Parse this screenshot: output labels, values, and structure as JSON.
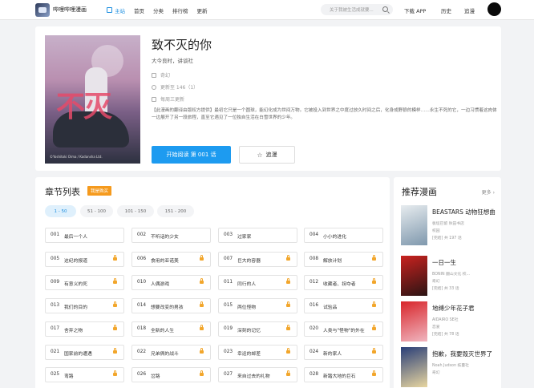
{
  "header": {
    "brand": "哔哩哔哩漫画",
    "nav": [
      {
        "label": "主站",
        "active": true
      },
      {
        "label": "首页",
        "active": false
      },
      {
        "label": "分类",
        "active": false
      },
      {
        "label": "排行榜",
        "active": false
      },
      {
        "label": "更新",
        "active": false
      }
    ],
    "search_placeholder": "关于我被生活成就要...",
    "download": "下载 APP",
    "history": "历史",
    "follow": "追漫"
  },
  "comic": {
    "title": "致不灭的你",
    "author": "大今良时，讲谈社",
    "genre": "奇幻",
    "update_status": "更新至 146（1）",
    "schedule": "每周三更新",
    "description": "【此漫画的翻译由版权方提供】最初它只是一个圆球，能幻化成为世间万物。它被投入到世界之中度过放久时间之后，化身成野狼的模样……永生不死的它，一边习惯着这肉体一边展开了另一段旅程，直至它遇见了一位独自生活在白雪世界的少年。",
    "cover_credit": "©Yoshitoki Oima / Kodansha Ltd.",
    "read_button": "开始阅读 第 001 话",
    "follow_button": "追漫"
  },
  "chapters": {
    "title": "章节列表",
    "badge": "我是购买",
    "ranges": [
      "1 - 50",
      "51 - 100",
      "101 - 150",
      "151 - 200"
    ],
    "items": [
      {
        "num": "001",
        "name": "最后一个人",
        "locked": false
      },
      {
        "num": "002",
        "name": "不听话的少女",
        "locked": false
      },
      {
        "num": "003",
        "name": "过家家",
        "locked": false
      },
      {
        "num": "004",
        "name": "小小的进化",
        "locked": false
      },
      {
        "num": "005",
        "name": "这纪的报道",
        "locked": true
      },
      {
        "num": "006",
        "name": "食用的亚诺美",
        "locked": true
      },
      {
        "num": "007",
        "name": "巨大的容器",
        "locked": true
      },
      {
        "num": "008",
        "name": "解放计划",
        "locked": true
      },
      {
        "num": "009",
        "name": "有意义的死",
        "locked": true
      },
      {
        "num": "010",
        "name": "人偶游戏",
        "locked": true
      },
      {
        "num": "011",
        "name": "同行的人",
        "locked": true
      },
      {
        "num": "012",
        "name": "收藏者、拐夺者",
        "locked": true
      },
      {
        "num": "013",
        "name": "我们的目的",
        "locked": true
      },
      {
        "num": "014",
        "name": "想要改变的男孩",
        "locked": true
      },
      {
        "num": "015",
        "name": "两位怪物",
        "locked": true
      },
      {
        "num": "016",
        "name": "试验品",
        "locked": true
      },
      {
        "num": "017",
        "name": "舍弃之物",
        "locked": true
      },
      {
        "num": "018",
        "name": "全新的人生",
        "locked": true
      },
      {
        "num": "019",
        "name": "深刻的记忆",
        "locked": true
      },
      {
        "num": "020",
        "name": "人类与\"怪物\"的外在",
        "locked": true
      },
      {
        "num": "021",
        "name": "国家前的遭遇",
        "locked": true
      },
      {
        "num": "022",
        "name": "兄弟俩的战斗",
        "locked": true
      },
      {
        "num": "023",
        "name": "幸运的邮差",
        "locked": true
      },
      {
        "num": "024",
        "name": "新的家人",
        "locked": true
      },
      {
        "num": "025",
        "name": "弯路",
        "locked": true
      },
      {
        "num": "026",
        "name": "岔路",
        "locked": true
      },
      {
        "num": "027",
        "name": "来自过去的礼物",
        "locked": true
      },
      {
        "num": "028",
        "name": "新踏大地的巨石",
        "locked": true
      }
    ]
  },
  "recommend": {
    "title": "推荐漫画",
    "more": "更多",
    "items": [
      {
        "name": "BEASTARS 动物狂想曲",
        "line1": "板垣巴留 秋田书店",
        "line2": "校园",
        "line3": "[完结] 共 197 话",
        "color1": "#e7ecef",
        "color2": "#7f98ad"
      },
      {
        "name": "一日一生",
        "line1": "BONIN 翻山文化 校...",
        "line2": "奇幻",
        "line3": "[完结] 共 33 话",
        "color1": "#c9221f",
        "color2": "#2b1414"
      },
      {
        "name": "地缚少年花子君",
        "line1": "AIDAIRO SE社",
        "line2": "恋爱",
        "line3": "[完结] 共 78 话",
        "color1": "#d8262b",
        "color2": "#f0b6c0"
      },
      {
        "name": "抱歉，我要毁灭世界了",
        "line1": "Noah Judson 枝蔓社",
        "line2": "奇幻",
        "line3": "",
        "color1": "#2a3f78",
        "color2": "#e8d6a0"
      }
    ]
  }
}
